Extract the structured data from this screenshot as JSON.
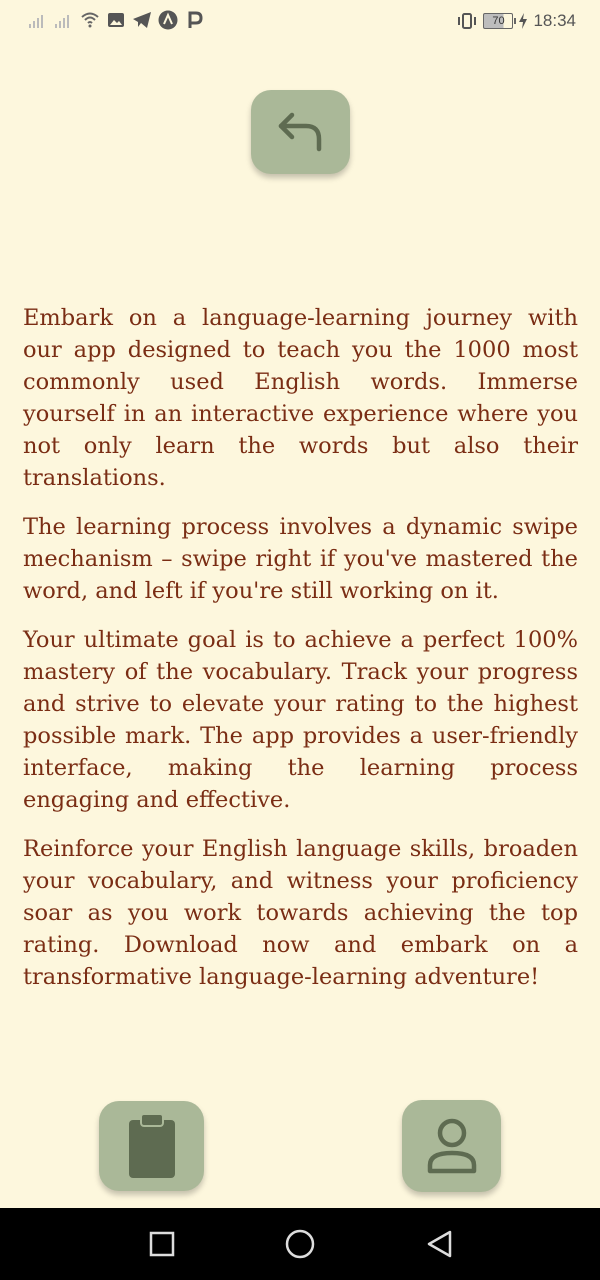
{
  "status_bar": {
    "time": "18:34",
    "battery": "70",
    "left_icons": [
      "signal-icon",
      "signal-icon",
      "wifi-icon",
      "image-icon",
      "telegram-icon",
      "app-a-icon",
      "app-p-icon"
    ],
    "right_icons": [
      "vibrate-icon",
      "battery-icon",
      "charging-icon"
    ]
  },
  "header": {
    "back_icon": "undo-arrow-icon"
  },
  "description": {
    "paragraphs": [
      "Embark on a language-learning journey with our app designed to teach you the 1000 most commonly used English words. Immerse yourself in an interactive experience where you not only learn the words but also their translations.",
      "The learning process involves a dynamic swipe mechanism – swipe right if you've mastered the word, and left if you're still working on it.",
      "Your ultimate goal is to achieve a perfect 100% mastery of the vocabulary. Track your progress and strive to elevate your rating to the highest possible mark. The app provides a user-friendly interface, making the learning process engaging and effective.",
      "Reinforce your English language skills, broaden your vocabulary, and witness your proficiency soar as you work towards achieving the top rating. Download now and embark on a transformative language-learning adventure!"
    ]
  },
  "bottom_buttons": {
    "left_icon": "clipboard-icon",
    "right_icon": "user-profile-icon"
  },
  "navigation": {
    "recents_icon": "square-icon",
    "home_icon": "circle-icon",
    "back_icon": "triangle-back-icon"
  },
  "colors": {
    "background": "#fdf7dd",
    "text": "#7a2d14",
    "button": "#aab898",
    "button_icon": "#5e6b51"
  }
}
